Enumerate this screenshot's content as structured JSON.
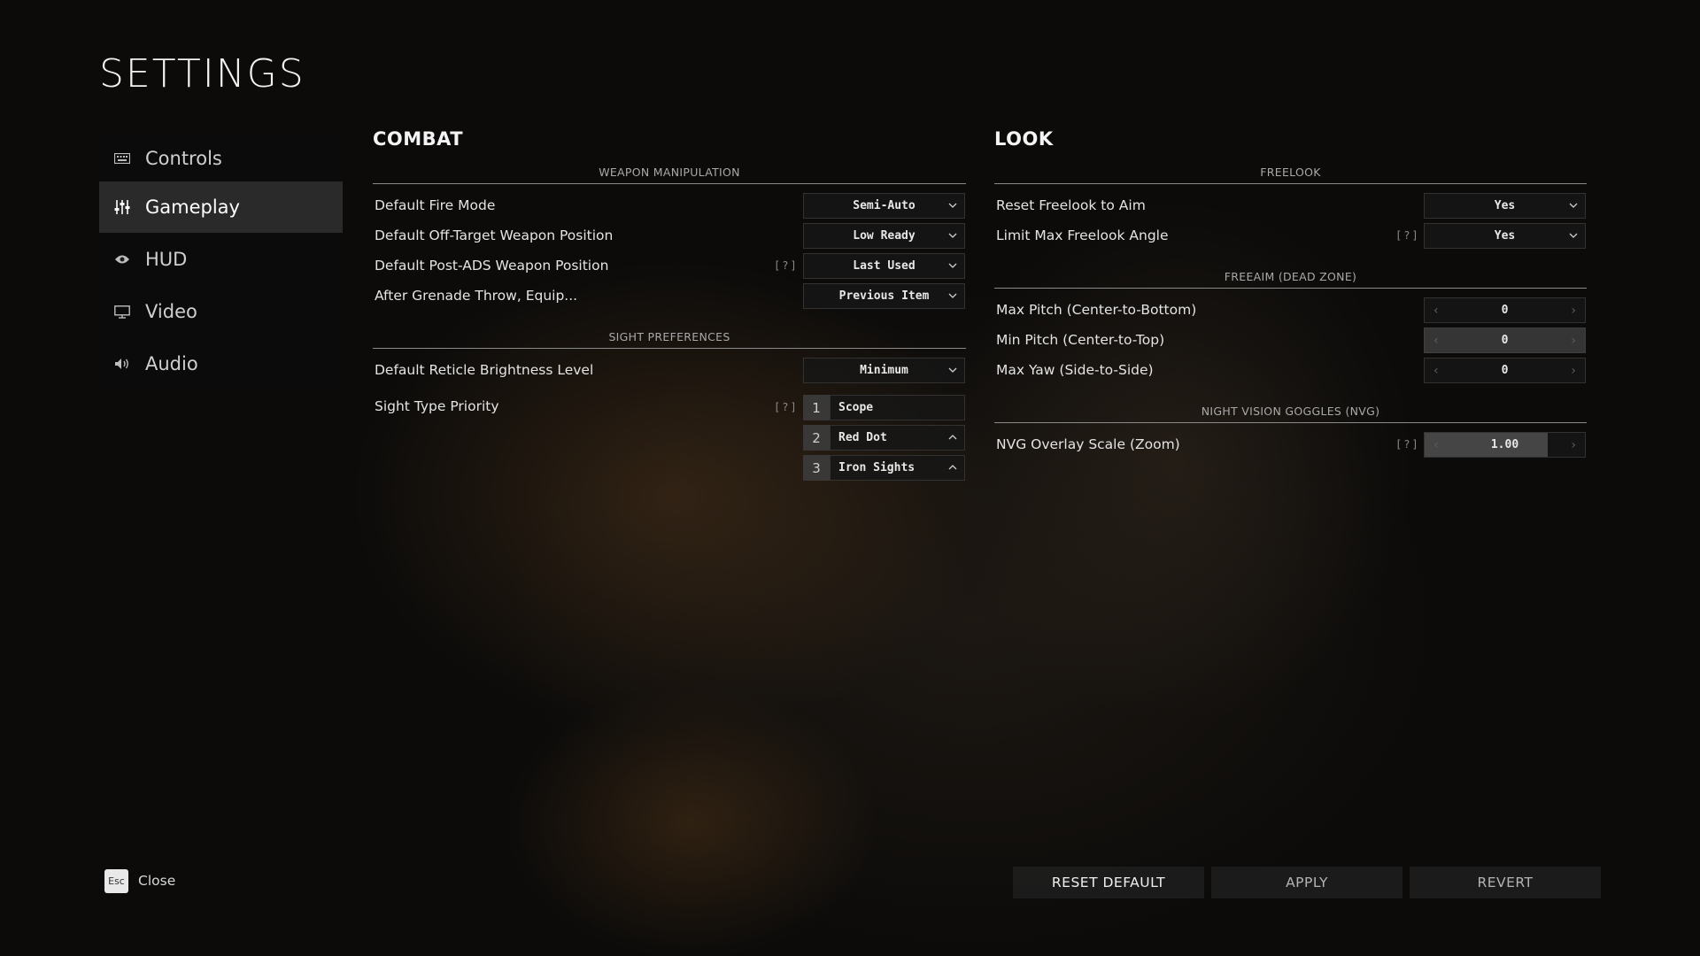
{
  "page": {
    "title": "SETTINGS"
  },
  "sidebar": {
    "items": [
      {
        "label": "Controls",
        "icon": "keyboard-icon",
        "active": false
      },
      {
        "label": "Gameplay",
        "icon": "sliders-icon",
        "active": true
      },
      {
        "label": "HUD",
        "icon": "eye-icon",
        "active": false
      },
      {
        "label": "Video",
        "icon": "monitor-icon",
        "active": false
      },
      {
        "label": "Audio",
        "icon": "speaker-icon",
        "active": false
      }
    ]
  },
  "combat": {
    "title": "COMBAT",
    "weapon_manipulation": {
      "heading": "WEAPON MANIPULATION",
      "rows": [
        {
          "label": "Default Fire Mode",
          "value": "Semi-Auto"
        },
        {
          "label": "Default Off-Target Weapon Position",
          "value": "Low Ready"
        },
        {
          "label": "Default Post-ADS Weapon Position",
          "value": "Last Used",
          "help": "[?]"
        },
        {
          "label": "After Grenade Throw, Equip...",
          "value": "Previous Item"
        }
      ]
    },
    "sight_preferences": {
      "heading": "SIGHT PREFERENCES",
      "reticle": {
        "label": "Default Reticle Brightness Level",
        "value": "Minimum"
      },
      "priority": {
        "label": "Sight Type Priority",
        "help": "[?]",
        "items": [
          {
            "num": "1",
            "value": "Scope"
          },
          {
            "num": "2",
            "value": "Red Dot"
          },
          {
            "num": "3",
            "value": "Iron Sights"
          }
        ]
      }
    }
  },
  "look": {
    "title": "LOOK",
    "freelook": {
      "heading": "FREELOOK",
      "rows": [
        {
          "label": "Reset Freelook to Aim",
          "value": "Yes"
        },
        {
          "label": "Limit Max Freelook Angle",
          "value": "Yes",
          "help": "[?]"
        }
      ]
    },
    "freeaim": {
      "heading": "FREEAIM (DEAD ZONE)",
      "rows": [
        {
          "label": "Max Pitch (Center-to-Bottom)",
          "value": "0"
        },
        {
          "label": "Min Pitch (Center-to-Top)",
          "value": "0"
        },
        {
          "label": "Max Yaw (Side-to-Side)",
          "value": "0"
        }
      ]
    },
    "nvg": {
      "heading": "NIGHT VISION GOGGLES (NVG)",
      "rows": [
        {
          "label": "NVG Overlay Scale (Zoom)",
          "value": "1.00",
          "help": "[?]",
          "fill_fraction": 0.77
        }
      ]
    }
  },
  "footer": {
    "esc_key": "Esc",
    "close_label": "Close",
    "buttons": {
      "reset": "RESET DEFAULT",
      "apply": "APPLY",
      "revert": "REVERT"
    }
  },
  "colors": {
    "background": "#0c0b0a",
    "active_nav": "#303030",
    "text": "#e4e4e4",
    "muted": "#a9a9a9"
  }
}
